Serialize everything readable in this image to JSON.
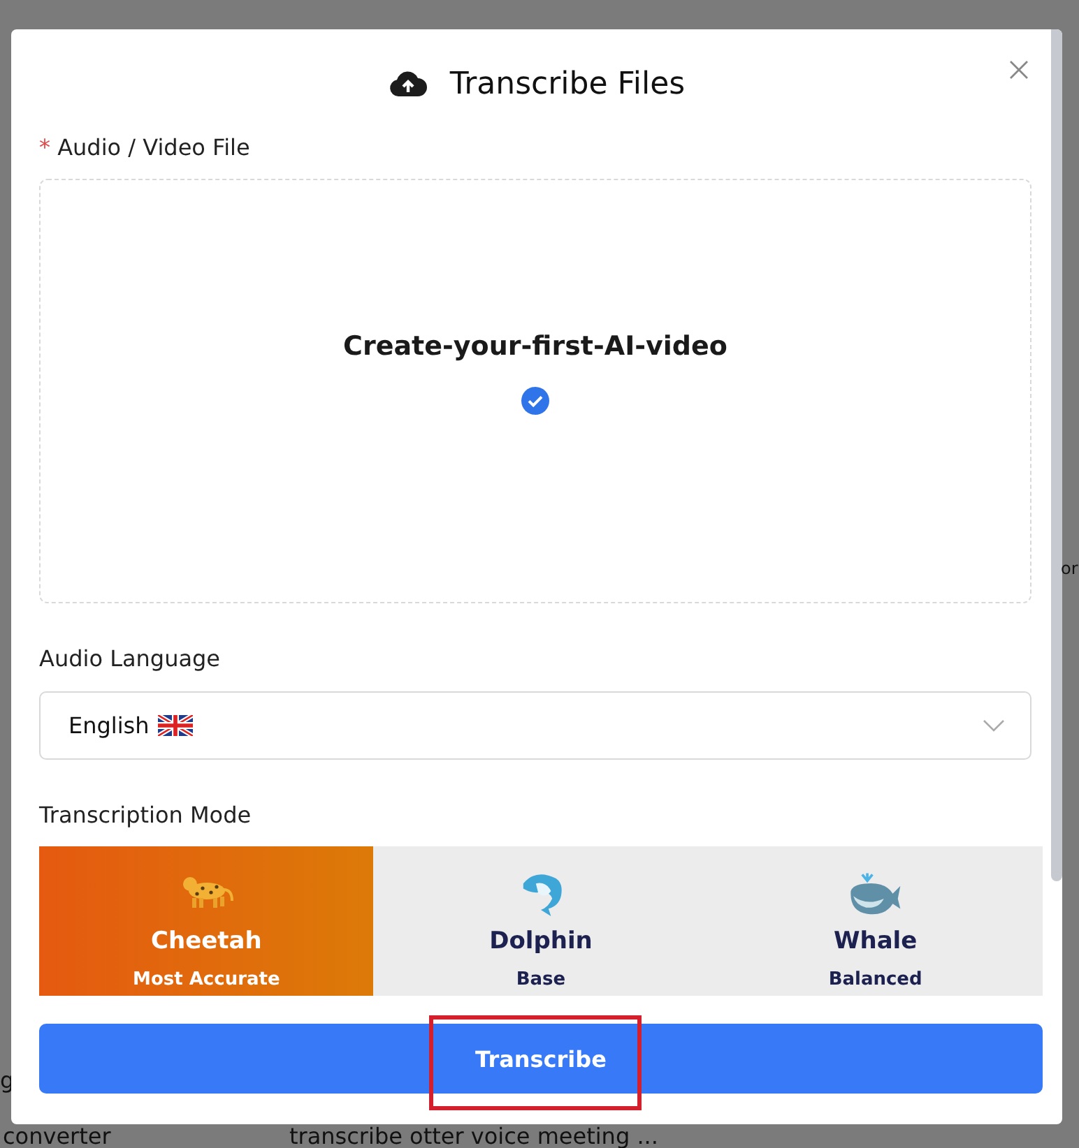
{
  "background": {
    "side_fragment": "or",
    "left_fragment": "g",
    "bottom_texts": [
      "converter",
      "transcribe otter voice meeting ..."
    ]
  },
  "dialog": {
    "title": "Transcribe Files",
    "file_label": "Audio / Video File",
    "required_mark": "*",
    "file_name": "Create-your-first-AI-video",
    "uploaded": true,
    "language_label": "Audio Language",
    "language": "English",
    "mode_label": "Transcription Mode",
    "modes": [
      {
        "name": "Cheetah",
        "subtitle": "Most Accurate",
        "kind": "cheetah",
        "selected": true
      },
      {
        "name": "Dolphin",
        "subtitle": "Base",
        "kind": "dolphin",
        "selected": false
      },
      {
        "name": "Whale",
        "subtitle": "Balanced",
        "kind": "whale",
        "selected": false
      }
    ],
    "submit": "Transcribe",
    "highlighted": true
  }
}
